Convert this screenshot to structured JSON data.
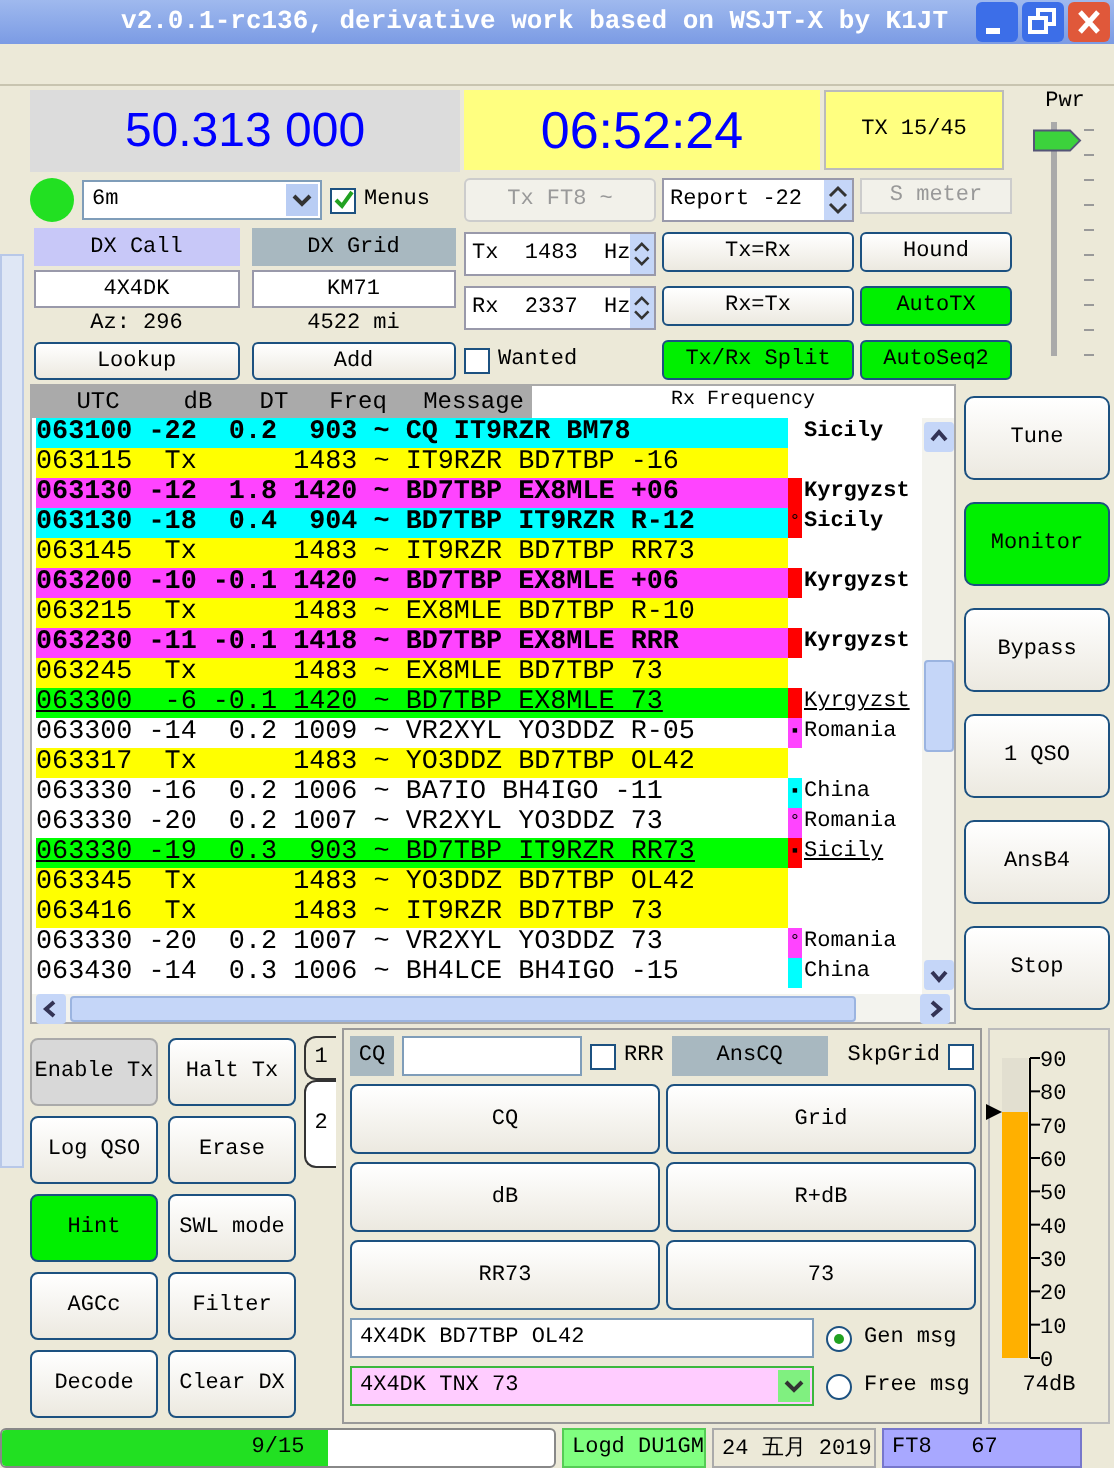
{
  "window": {
    "title": "v2.0.1-rc136, derivative work based on WSJT-X by K1JT"
  },
  "top": {
    "frequency": "50.313 000",
    "indicator": {
      "on": true
    },
    "band": "6m",
    "menus": {
      "label": "Menus",
      "checked": true
    },
    "dx_call": {
      "label": "DX Call",
      "value": "4X4DK",
      "info": "Az: 296"
    },
    "dx_grid": {
      "label": "DX Grid",
      "value": "KM71",
      "info": "4522 mi"
    },
    "lookup": "Lookup",
    "add": "Add",
    "clock": "06:52:24",
    "tx_period": "TX 15/45",
    "mode": {
      "label": "Tx FT8 ~",
      "disabled": true
    },
    "report": "Report -22",
    "s_meter": {
      "label": "S meter",
      "disabled": true
    },
    "tx_freq": {
      "prefix": "Tx",
      "value": "1483",
      "unit": "Hz"
    },
    "rx_freq": {
      "prefix": "Rx",
      "value": "2337",
      "unit": "Hz"
    },
    "wanted": {
      "label": "Wanted",
      "checked": false
    },
    "controls": [
      {
        "label": "Tx=Rx",
        "on": false
      },
      {
        "label": "Hound",
        "on": false
      },
      {
        "label": "Rx=Tx",
        "on": false
      },
      {
        "label": "AutoTX",
        "on": true
      },
      {
        "label": "Tx/Rx Split",
        "on": true
      },
      {
        "label": "AutoSeq2",
        "on": true
      }
    ],
    "power": {
      "label": "Pwr",
      "level": 0.97
    }
  },
  "decodes": {
    "columns": [
      "UTC",
      "dB",
      "DT",
      "Freq",
      "Message"
    ],
    "rx_label": "Rx Frequency",
    "rows": [
      {
        "text": "063100 -22  0.2  903 ~ CQ IT9RZR BM78",
        "kind": "cq",
        "country": "Sicily"
      },
      {
        "text": "063115  Tx      1483 ~ IT9RZR BD7TBP -16",
        "kind": "tx"
      },
      {
        "text": "063130 -12  1.8 1420 ~ BD7TBP EX8MLE +06",
        "kind": "to_me",
        "color": "#ff0000",
        "country": "Kyrgyzst"
      },
      {
        "text": "063130 -18  0.4  904 ~ BD7TBP IT9RZR R-12",
        "kind": "cq",
        "color": "#ff0000",
        "mark": "°",
        "country": "Sicily"
      },
      {
        "text": "063145  Tx      1483 ~ IT9RZR BD7TBP RR73",
        "kind": "tx"
      },
      {
        "text": "063200 -10 -0.1 1420 ~ BD7TBP EX8MLE +06",
        "kind": "to_me",
        "color": "#ff0000",
        "country": "Kyrgyzst"
      },
      {
        "text": "063215  Tx      1483 ~ EX8MLE BD7TBP R-10",
        "kind": "tx"
      },
      {
        "text": "063230 -11 -0.1 1418 ~ BD7TBP EX8MLE RRR",
        "kind": "to_me",
        "color": "#ff0000",
        "country": "Kyrgyzst"
      },
      {
        "text": "063245  Tx      1483 ~ EX8MLE BD7TBP 73",
        "kind": "tx"
      },
      {
        "text": "063300  -6 -0.1 1420 ~ BD7TBP EX8MLE 73",
        "kind": "done",
        "color": "#ff0000",
        "country": "Kyrgyzst"
      },
      {
        "text": "063300 -14  0.2 1009 ~ VR2XYL YO3DDZ R-05",
        "kind": "plain",
        "color": "#ff44ff",
        "mark": "▪",
        "country": "Romania"
      },
      {
        "text": "063317  Tx      1483 ~ YO3DDZ BD7TBP OL42",
        "kind": "tx"
      },
      {
        "text": "063330 -16  0.2 1006 ~ BA7IO BH4IGO -11",
        "kind": "plain",
        "color": "#00ffff",
        "mark": "▪",
        "country": "China"
      },
      {
        "text": "063330 -20  0.2 1007 ~ VR2XYL YO3DDZ 73",
        "kind": "plain",
        "color": "#ff44ff",
        "mark": "°",
        "country": "Romania"
      },
      {
        "text": "063330 -19  0.3  903 ~ BD7TBP IT9RZR RR73",
        "kind": "done",
        "color": "#ff0000",
        "mark": "▪",
        "country": "Sicily"
      },
      {
        "text": "063345  Tx      1483 ~ YO3DDZ BD7TBP OL42",
        "kind": "tx"
      },
      {
        "text": "063416  Tx      1483 ~ IT9RZR BD7TBP 73",
        "kind": "tx"
      },
      {
        "text": "063330 -20  0.2 1007 ~ VR2XYL YO3DDZ 73",
        "kind": "plain",
        "color": "#ff44ff",
        "mark": "°",
        "country": "Romania"
      },
      {
        "text": "063430 -14  0.3 1006 ~ BH4LCE BH4IGO -15",
        "kind": "plain",
        "color": "#00ffff",
        "country": "China"
      }
    ]
  },
  "side_buttons": [
    {
      "label": "Tune",
      "on": false
    },
    {
      "label": "Monitor",
      "on": true
    },
    {
      "label": "Bypass",
      "on": false
    },
    {
      "label": "1 QSO",
      "on": false
    },
    {
      "label": "AnsB4",
      "on": false
    },
    {
      "label": "Stop",
      "on": false
    }
  ],
  "left_buttons": [
    {
      "label": "Enable Tx",
      "kind": "flat",
      "on": false
    },
    {
      "label": "Halt Tx",
      "kind": "push",
      "on": false
    },
    {
      "label": "Log QSO",
      "kind": "push",
      "on": false
    },
    {
      "label": "Erase",
      "kind": "push",
      "on": false
    },
    {
      "label": "Hint",
      "kind": "push",
      "on": true
    },
    {
      "label": "SWL mode",
      "kind": "push",
      "on": false
    },
    {
      "label": "AGCc",
      "kind": "push",
      "on": false
    },
    {
      "label": "Filter",
      "kind": "push",
      "on": false
    },
    {
      "label": "Decode",
      "kind": "push",
      "on": false
    },
    {
      "label": "Clear DX",
      "kind": "push",
      "on": false
    }
  ],
  "tabs": [
    {
      "label": "1",
      "selected": false
    },
    {
      "label": "2",
      "selected": true
    }
  ],
  "messages": {
    "cq_label": "CQ",
    "rrr": {
      "label": "RRR",
      "checked": false
    },
    "ans_cq": "AnsCQ",
    "skip_grid": {
      "label": "SkpGrid",
      "checked": false
    },
    "buttons": [
      "CQ",
      "Grid",
      "dB",
      "R+dB",
      "RR73",
      "73"
    ],
    "gen": {
      "value": "4X4DK BD7TBP OL42",
      "label": "Gen msg",
      "selected": true
    },
    "free": {
      "value": "4X4DK TNX 73",
      "label": "Free msg",
      "selected": false
    }
  },
  "meter": {
    "scale": [
      "90",
      "80",
      "70",
      "60",
      "50",
      "40",
      "30",
      "20",
      "10",
      "0"
    ],
    "level": 0.82,
    "reading": "74dB"
  },
  "status_bar": {
    "progress": {
      "label": "9/15",
      "level": 0.59
    },
    "logged": "Logd DU1GM",
    "date": "24 五月 2019",
    "mode": "FT8   67"
  }
}
